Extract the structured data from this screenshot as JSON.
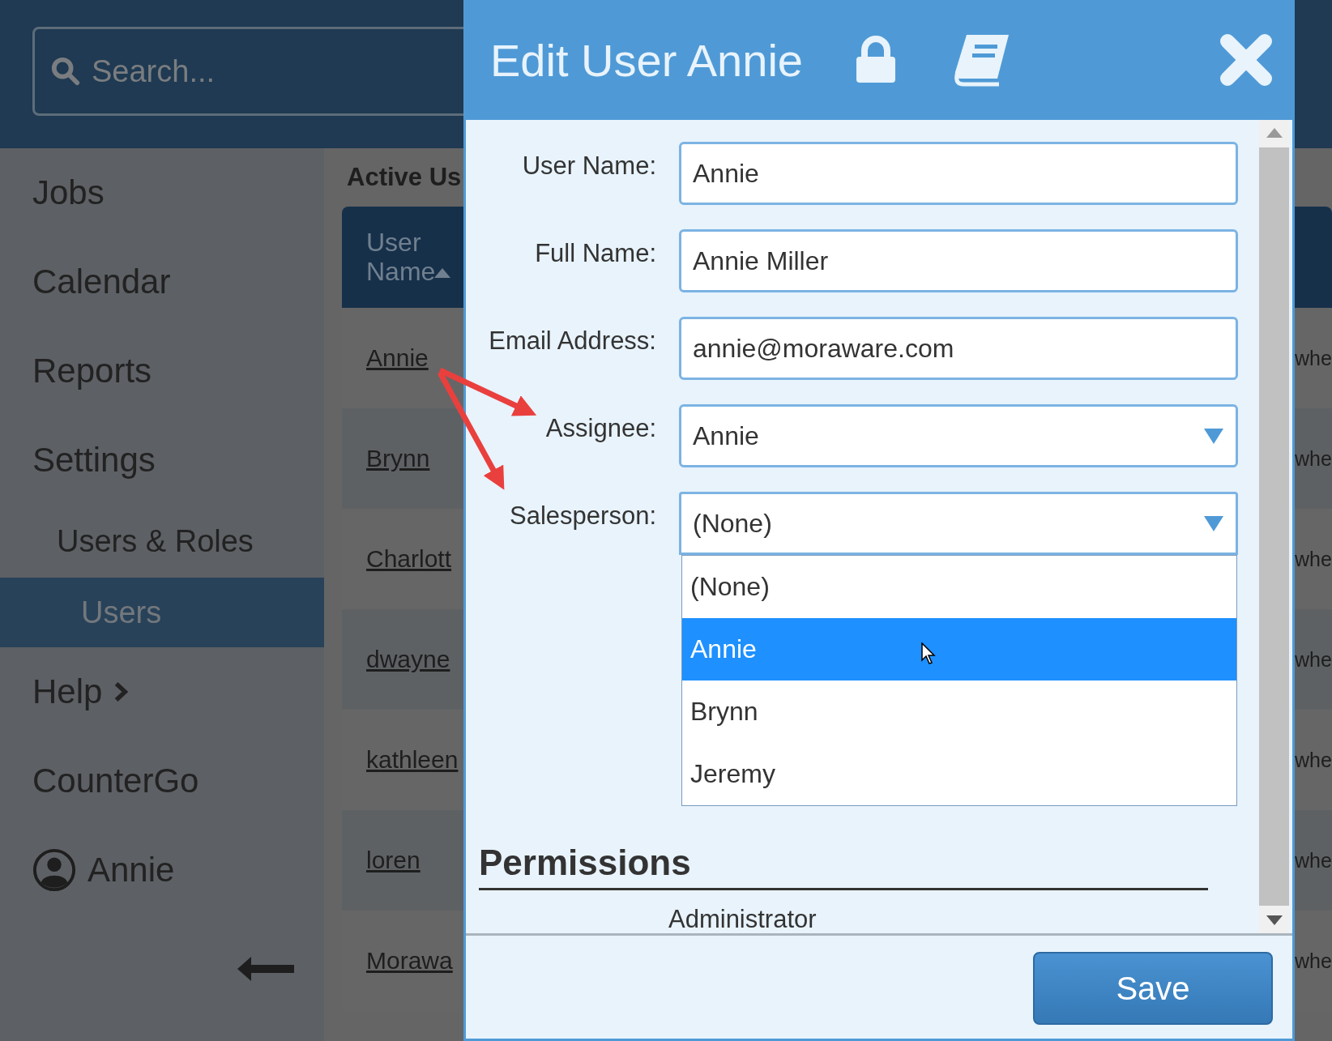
{
  "search": {
    "placeholder": "Search..."
  },
  "sidebar": {
    "items": [
      {
        "label": "Jobs",
        "kind": "item",
        "selected": false
      },
      {
        "label": "Calendar",
        "kind": "item",
        "selected": false
      },
      {
        "label": "Reports",
        "kind": "item",
        "selected": false
      },
      {
        "label": "Settings",
        "kind": "item",
        "selected": false
      },
      {
        "label": "Users & Roles",
        "kind": "sub",
        "selected": false
      },
      {
        "label": "Users",
        "kind": "subsub",
        "selected": true
      },
      {
        "label": "Help",
        "kind": "expandable",
        "selected": false
      },
      {
        "label": "CounterGo",
        "kind": "item",
        "selected": false
      },
      {
        "label": "Annie",
        "kind": "user",
        "selected": false
      }
    ]
  },
  "main": {
    "heading": "Active Us",
    "table": {
      "columns": [
        "User Name"
      ],
      "rows": [
        {
          "user_name": "Annie",
          "column_2": "whe"
        },
        {
          "user_name": "Brynn",
          "column_2": "whe"
        },
        {
          "user_name": "Charlott",
          "column_2": "whe"
        },
        {
          "user_name": "dwayne",
          "column_2": "whe"
        },
        {
          "user_name": "kathleen",
          "column_2": "whe"
        },
        {
          "user_name": "loren",
          "column_2": "whe"
        },
        {
          "user_name": "Morawa",
          "column_2": "whe"
        }
      ]
    }
  },
  "dialog": {
    "title": "Edit User Annie",
    "fields": [
      {
        "label": "User Name:",
        "value": "Annie",
        "kind": "text"
      },
      {
        "label": "Full Name:",
        "value": "Annie Miller",
        "kind": "text"
      },
      {
        "label": "Email Address:",
        "value": "annie@moraware.com",
        "kind": "text"
      },
      {
        "label": "Assignee:",
        "value": "Annie",
        "kind": "select",
        "expanded": false
      },
      {
        "label": "Salesperson:",
        "value": "(None)",
        "kind": "select",
        "expanded": true
      }
    ],
    "options": [
      {
        "label": "(None)",
        "selected": false
      },
      {
        "label": "Annie",
        "selected": true
      },
      {
        "label": "Brynn",
        "selected": false
      },
      {
        "label": "Jeremy",
        "selected": false
      }
    ],
    "section_title": "Permissions",
    "permission_label": "Administrator",
    "save_button": "Save"
  }
}
